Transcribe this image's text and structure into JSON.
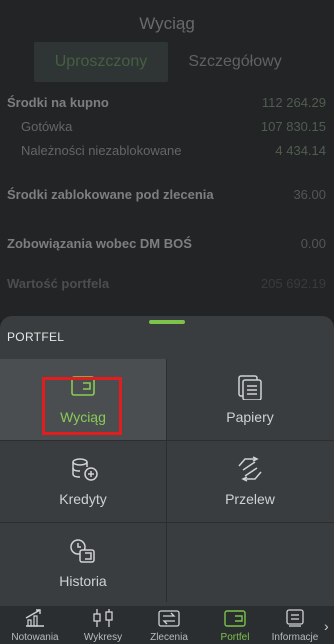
{
  "background": {
    "title": "Wyciąg",
    "segments": [
      "Uproszczony",
      "Szczegółowy"
    ],
    "rows": [
      {
        "label": "Środki na kupno",
        "value": "112 264.29"
      },
      {
        "label": "Gotówka",
        "value": "107 830.15"
      },
      {
        "label": "Należności niezablokowane",
        "value": "4 434.14"
      },
      {
        "label": "Środki zablokowane pod zlecenia",
        "value": "36.00"
      },
      {
        "label": "Zobowiązania wobec DM BOŚ",
        "value": "0.00"
      },
      {
        "label": "Wartość portfela",
        "value": "205 692.19"
      }
    ]
  },
  "sheet": {
    "title": "PORTFEL",
    "items": [
      {
        "label": "Wyciąg",
        "icon": "wallet-icon"
      },
      {
        "label": "Papiery",
        "icon": "documents-icon"
      },
      {
        "label": "Kredyty",
        "icon": "coins-plus-icon"
      },
      {
        "label": "Przelew",
        "icon": "transfer-icon"
      },
      {
        "label": "Historia",
        "icon": "history-icon"
      }
    ]
  },
  "tabbar": {
    "tabs": [
      {
        "label": "Notowania",
        "icon": "chart-up-icon"
      },
      {
        "label": "Wykresy",
        "icon": "candlestick-icon"
      },
      {
        "label": "Zlecenia",
        "icon": "orders-icon"
      },
      {
        "label": "Portfel",
        "icon": "wallet-icon"
      },
      {
        "label": "Informacje",
        "icon": "news-icon"
      }
    ],
    "more_label": "›"
  },
  "colors": {
    "accent_green": "#7dc24a",
    "highlight_red": "#e11d1d",
    "sheet_bg": "#3a3d3f"
  }
}
